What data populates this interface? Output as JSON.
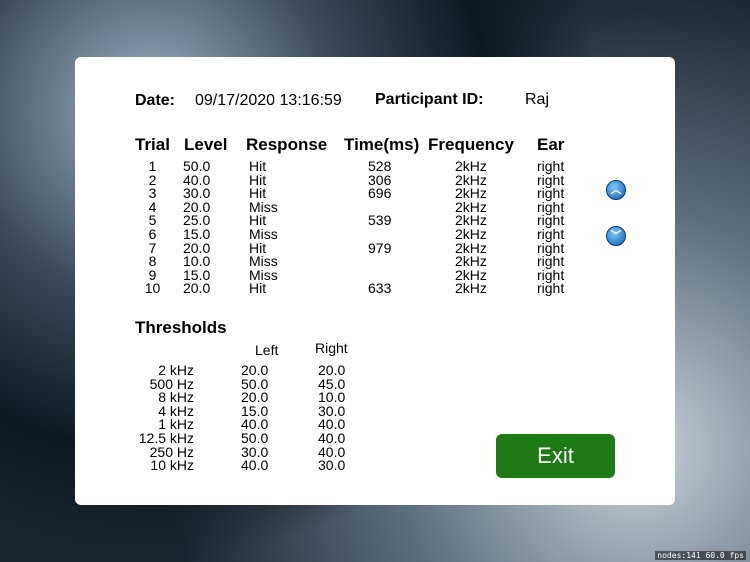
{
  "header": {
    "date_label": "Date:",
    "date_value": "09/17/2020 13:16:59",
    "participant_label": "Participant ID:",
    "participant_value": "Raj"
  },
  "trials": {
    "headers": [
      "Trial",
      "Level",
      "Response",
      "Time(ms)",
      "Frequency",
      "Ear"
    ],
    "trial": [
      "1",
      "2",
      "3",
      "4",
      "5",
      "6",
      "7",
      "8",
      "9",
      "10"
    ],
    "level": [
      "50.0",
      "40.0",
      "30.0",
      "20.0",
      "25.0",
      "15.0",
      "20.0",
      "10.0",
      "15.0",
      "20.0"
    ],
    "response": [
      "Hit",
      "Hit",
      "Hit",
      "Miss",
      "Hit",
      "Miss",
      "Hit",
      "Miss",
      "Miss",
      "Hit"
    ],
    "time": [
      "528",
      "306",
      "696",
      "",
      "539",
      "",
      "979",
      "",
      "",
      "633"
    ],
    "frequency": [
      "2kHz",
      "2kHz",
      "2kHz",
      "2kHz",
      "2kHz",
      "2kHz",
      "2kHz",
      "2kHz",
      "2kHz",
      "2kHz"
    ],
    "ear": [
      "right",
      "right",
      "right",
      "right",
      "right",
      "right",
      "right",
      "right",
      "right",
      "right"
    ]
  },
  "thresholds": {
    "title": "Thresholds",
    "left_label": "Left",
    "right_label": "Right",
    "freq": [
      "2 kHz",
      "500 Hz",
      "8 kHz",
      "4 kHz",
      "1 kHz",
      "12.5 kHz",
      "250 Hz",
      "10 kHz"
    ],
    "left": [
      "20.0",
      "50.0",
      "20.0",
      "15.0",
      "40.0",
      "50.0",
      "30.0",
      "40.0"
    ],
    "right": [
      "20.0",
      "45.0",
      "10.0",
      "30.0",
      "40.0",
      "40.0",
      "40.0",
      "30.0"
    ]
  },
  "buttons": {
    "exit": "Exit",
    "up_icon": "chevron-up",
    "down_icon": "chevron-down"
  },
  "stats": "nodes:141  60.0 fps"
}
